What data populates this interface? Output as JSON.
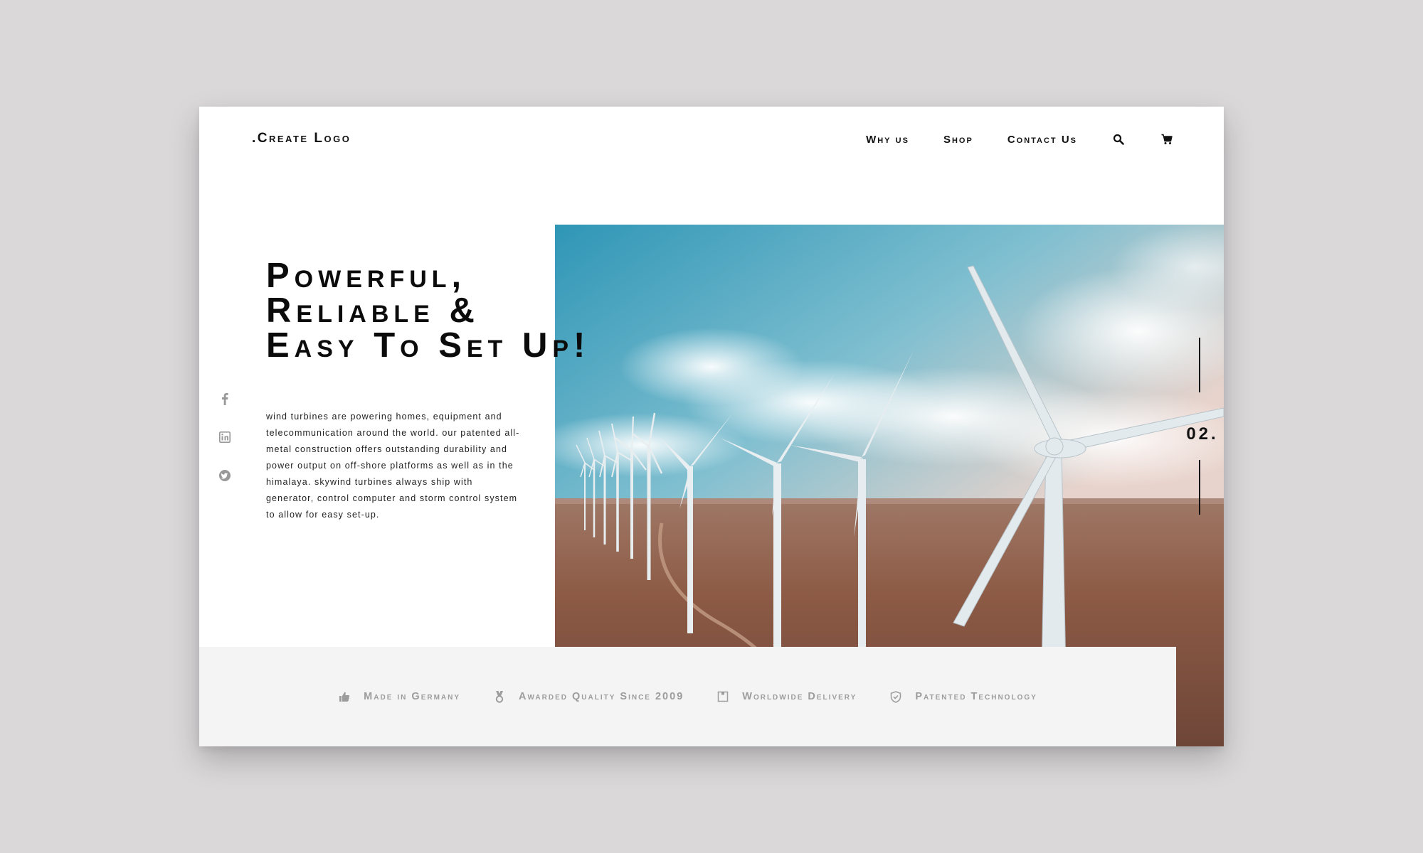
{
  "header": {
    "logo": ".Create Logo",
    "nav": [
      {
        "label": "Why us"
      },
      {
        "label": "Shop"
      },
      {
        "label": "Contact Us"
      }
    ],
    "icons": [
      "search-icon",
      "cart-icon"
    ]
  },
  "hero": {
    "title_lines": [
      "Powerful,",
      "Reliable &",
      "Easy To Set Up!"
    ],
    "description": "wind turbines are powering homes, equipment and telecommunication around the world. our patented all-metal construction offers outstanding durability and power output on off-shore platforms as well as in the himalaya. skywind turbines always ship with generator, control computer and storm control system to allow for easy set-up.",
    "slide_number": "02."
  },
  "social": [
    "facebook-icon",
    "linkedin-icon",
    "twitter-icon"
  ],
  "features": [
    {
      "icon": "thumbs-up-icon",
      "label": "Made in Germany"
    },
    {
      "icon": "medal-icon",
      "label": "Awarded Quality Since 2009"
    },
    {
      "icon": "box-icon",
      "label": "Worldwide Delivery"
    },
    {
      "icon": "shield-check-icon",
      "label": "Patented Technology"
    }
  ],
  "colors": {
    "page_background": "#dad8d9",
    "card_background": "#ffffff",
    "text_dark": "#0b0b0b",
    "feature_bar": "#f4f4f4",
    "feature_text": "#9c9c9c",
    "sky_top": "#3e9db9",
    "ground": "#8a5a44"
  }
}
